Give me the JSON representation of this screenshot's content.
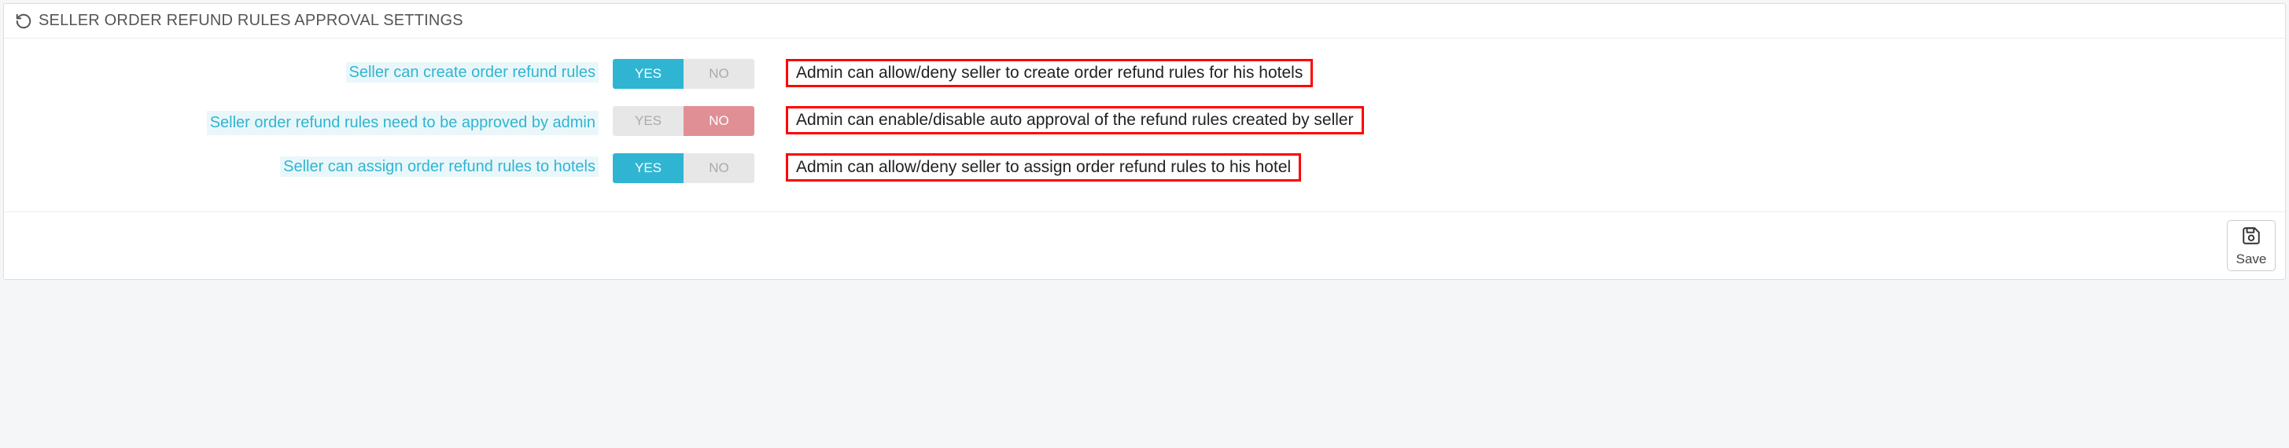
{
  "panel": {
    "title": "SELLER ORDER REFUND RULES APPROVAL SETTINGS",
    "footer": {
      "save_label": "Save"
    }
  },
  "toggle_labels": {
    "yes": "YES",
    "no": "NO"
  },
  "rows": [
    {
      "label": "Seller can create order refund rules",
      "value": "yes",
      "help": "Admin can allow/deny seller to create order refund rules for his hotels"
    },
    {
      "label": "Seller order refund rules need to be approved by admin",
      "value": "no",
      "help": "Admin can enable/disable auto approval of the refund rules created by seller"
    },
    {
      "label": "Seller can assign order refund rules to hotels",
      "value": "yes",
      "help": "Admin can allow/deny seller to assign order refund rules to his hotel"
    }
  ]
}
